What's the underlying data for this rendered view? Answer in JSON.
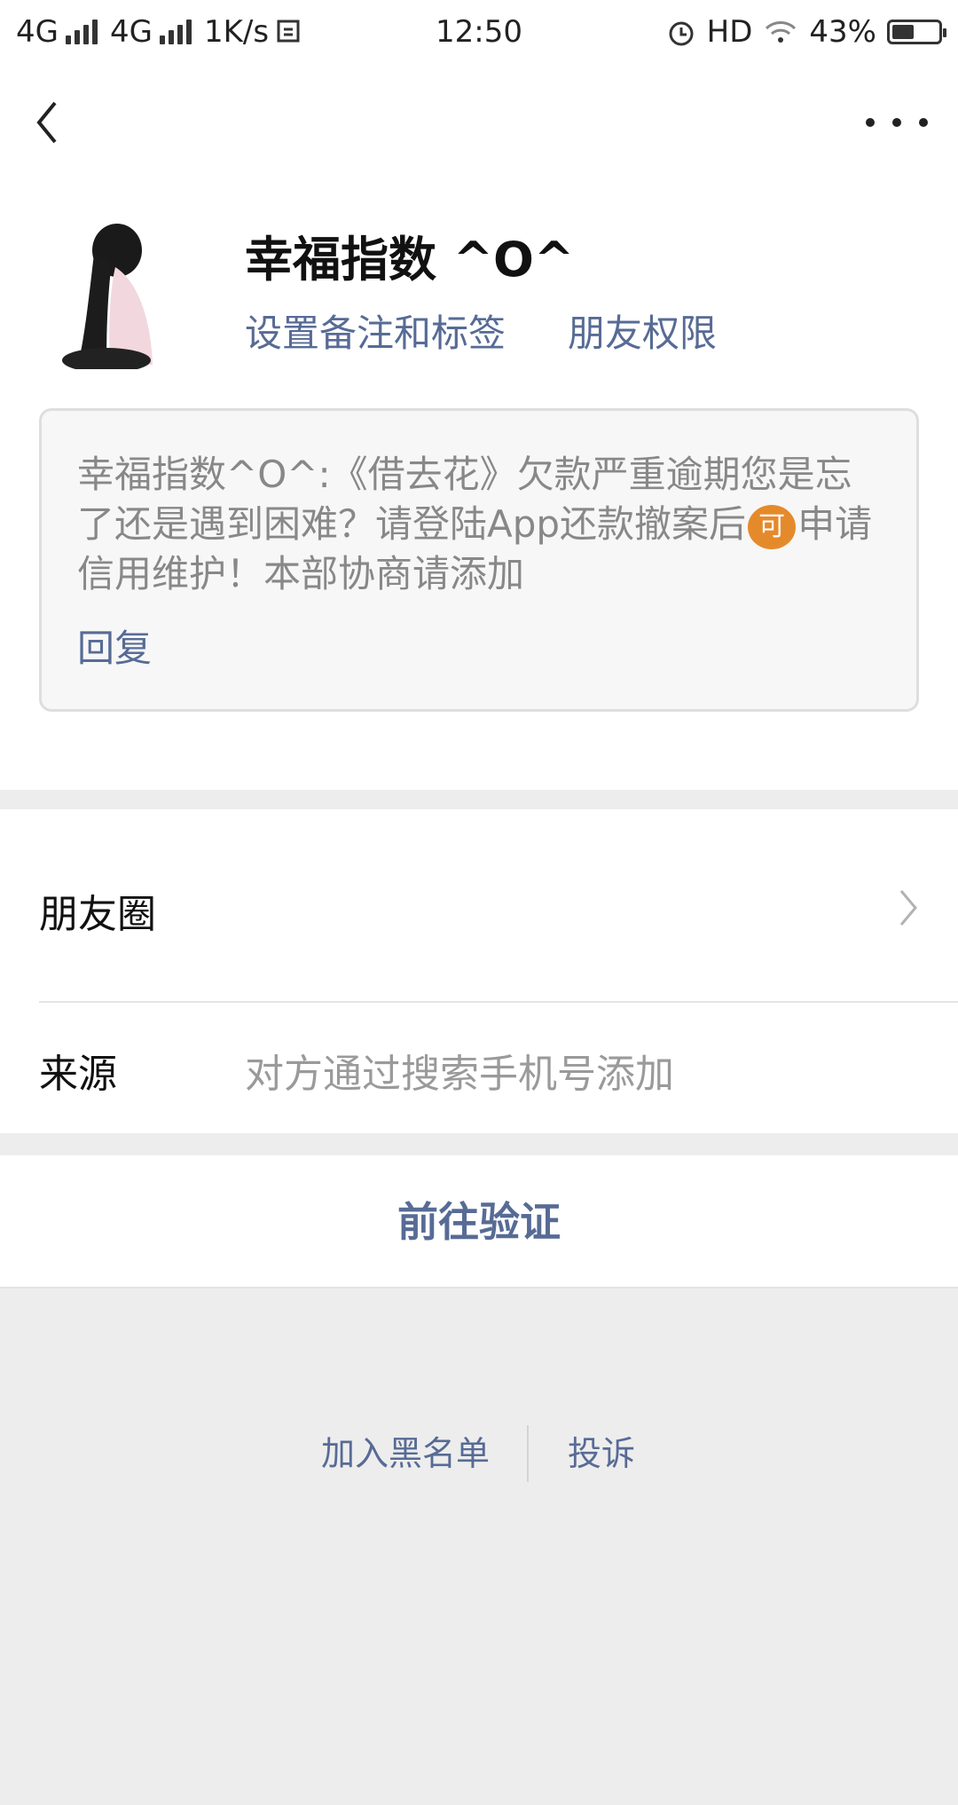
{
  "status_bar": {
    "net1": "4G",
    "net2": "4G",
    "speed": "1K/s",
    "time": "12:50",
    "hd": "HD",
    "battery": "43%",
    "battery_level": 0.43
  },
  "profile": {
    "name": "幸福指数 ^O^",
    "remark_link": "设置备注和标签",
    "permission_link": "朋友权限"
  },
  "message": {
    "text_part1": "幸福指数^O^:《借去花》欠款严重逾期您是忘了还是遇到困难？请登陆App还款撤案后",
    "emoji": "可",
    "text_part2": "申请信用维护！本部协商请添加",
    "reply": "回复"
  },
  "list": {
    "moments_label": "朋友圈",
    "source_label": "来源",
    "source_value": "对方通过搜索手机号添加"
  },
  "verify_button": "前往验证",
  "footer": {
    "block": "加入黑名单",
    "report": "投诉"
  },
  "colors": {
    "link": "#576b95",
    "background": "#ededed",
    "emoji_bg": "#e58a2b"
  }
}
